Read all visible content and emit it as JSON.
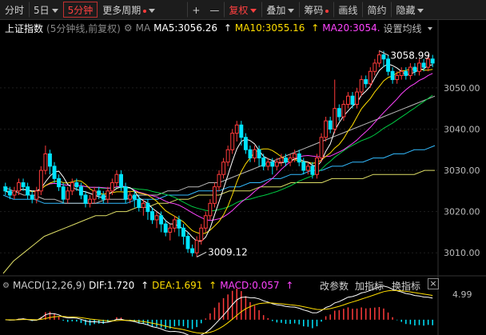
{
  "toolbar": {
    "items": [
      "分时",
      "5日",
      "5分钟",
      "更多周期",
      "+",
      "—",
      "复权",
      "叠加",
      "筹码",
      "画线",
      "简约",
      "隐藏"
    ]
  },
  "info": {
    "index_name": "上证指数",
    "period_desc": "(5分钟线,前复权)",
    "ma_label": "MA",
    "ma5": "MA5:3056.26",
    "ma10": "MA10:3055.16",
    "ma20": "MA20:3054.",
    "settings": "设置均线"
  },
  "macd": {
    "label": "MACD(12,26,9)",
    "dif": "DIF:1.720",
    "dea": "DEA:1.691",
    "macd": "MACD:0.057",
    "btn_params": "改参数",
    "btn_add": "加指标",
    "btn_switch": "换指标"
  },
  "colors": {
    "up": "#ff3b3b",
    "down": "#00e5ff",
    "ma5": "#ffffff",
    "ma10": "#ffdd00",
    "ma20": "#ff44ff",
    "ma30": "#00cc44",
    "ma60": "#bbbbbb",
    "ma120": "#33bbff",
    "ma250": "#dddd66"
  },
  "chart_data": {
    "type": "candlestick",
    "y_ticks": [
      "3050.00",
      "3040.00",
      "3030.00",
      "3020.00",
      "3010.00"
    ],
    "ylim": [
      3005,
      3062
    ],
    "high_label": "3058.99",
    "low_label": "3009.12",
    "bars": [
      [
        3026,
        3025,
        3027,
        3024
      ],
      [
        3025,
        3024,
        3026,
        3023
      ],
      [
        3024,
        3025,
        3026,
        3023
      ],
      [
        3025,
        3027,
        3028,
        3024
      ],
      [
        3027,
        3026,
        3028,
        3025
      ],
      [
        3026,
        3024,
        3027,
        3023
      ],
      [
        3024,
        3023,
        3025,
        3022
      ],
      [
        3023,
        3025,
        3026,
        3022
      ],
      [
        3025,
        3030,
        3031,
        3024
      ],
      [
        3030,
        3034,
        3036,
        3029
      ],
      [
        3034,
        3031,
        3035,
        3029
      ],
      [
        3031,
        3028,
        3032,
        3027
      ],
      [
        3028,
        3026,
        3029,
        3025
      ],
      [
        3026,
        3023,
        3027,
        3022
      ],
      [
        3023,
        3025,
        3026,
        3022
      ],
      [
        3025,
        3027,
        3028,
        3024
      ],
      [
        3027,
        3026,
        3028,
        3025
      ],
      [
        3026,
        3024,
        3027,
        3023
      ],
      [
        3024,
        3022,
        3025,
        3021
      ],
      [
        3022,
        3023,
        3024,
        3021
      ],
      [
        3023,
        3025,
        3026,
        3022
      ],
      [
        3025,
        3024,
        3026,
        3023
      ],
      [
        3024,
        3023,
        3025,
        3022
      ],
      [
        3023,
        3025,
        3026,
        3022
      ],
      [
        3025,
        3027,
        3028,
        3024
      ],
      [
        3027,
        3029,
        3030,
        3026
      ],
      [
        3029,
        3026,
        3030,
        3025
      ],
      [
        3026,
        3023,
        3027,
        3022
      ],
      [
        3023,
        3024,
        3025,
        3022
      ],
      [
        3024,
        3023,
        3025,
        3021
      ],
      [
        3023,
        3021,
        3024,
        3020
      ],
      [
        3021,
        3022,
        3023,
        3019
      ],
      [
        3022,
        3020,
        3023,
        3018
      ],
      [
        3020,
        3018,
        3021,
        3017
      ],
      [
        3018,
        3019,
        3020,
        3016
      ],
      [
        3019,
        3017,
        3020,
        3015
      ],
      [
        3017,
        3015,
        3018,
        3014
      ],
      [
        3015,
        3016,
        3017,
        3013
      ],
      [
        3016,
        3018,
        3019,
        3015
      ],
      [
        3018,
        3016,
        3019,
        3014
      ],
      [
        3016,
        3014,
        3017,
        3012
      ],
      [
        3014,
        3011,
        3015,
        3010
      ],
      [
        3011,
        3010,
        3012,
        3009.12
      ],
      [
        3010,
        3013,
        3014,
        3009
      ],
      [
        3013,
        3016,
        3017,
        3012
      ],
      [
        3016,
        3019,
        3020,
        3015
      ],
      [
        3019,
        3022,
        3023,
        3018
      ],
      [
        3022,
        3026,
        3027,
        3021
      ],
      [
        3026,
        3029,
        3030,
        3025
      ],
      [
        3029,
        3032,
        3033,
        3028
      ],
      [
        3032,
        3035,
        3036,
        3031
      ],
      [
        3035,
        3039,
        3040,
        3034
      ],
      [
        3039,
        3041,
        3042,
        3037
      ],
      [
        3041,
        3038,
        3042,
        3036
      ],
      [
        3038,
        3035,
        3039,
        3034
      ],
      [
        3035,
        3033,
        3036,
        3032
      ],
      [
        3033,
        3035,
        3036,
        3032
      ],
      [
        3035,
        3033,
        3036,
        3031
      ],
      [
        3033,
        3031,
        3034,
        3030
      ],
      [
        3031,
        3032,
        3033,
        3030
      ],
      [
        3032,
        3031,
        3033,
        3029
      ],
      [
        3031,
        3032,
        3033,
        3030
      ],
      [
        3032,
        3033,
        3034,
        3031
      ],
      [
        3033,
        3032,
        3034,
        3031
      ],
      [
        3032,
        3033,
        3034,
        3031
      ],
      [
        3033,
        3034,
        3035,
        3032
      ],
      [
        3034,
        3032,
        3035,
        3031
      ],
      [
        3032,
        3030,
        3033,
        3029
      ],
      [
        3030,
        3031,
        3032,
        3029
      ],
      [
        3031,
        3029,
        3032,
        3028
      ],
      [
        3029,
        3033,
        3034,
        3028
      ],
      [
        3033,
        3038,
        3039,
        3032
      ],
      [
        3038,
        3042,
        3043,
        3037
      ],
      [
        3042,
        3040,
        3043,
        3039
      ],
      [
        3040,
        3045,
        3052,
        3039
      ],
      [
        3045,
        3043,
        3046,
        3042
      ],
      [
        3043,
        3046,
        3047,
        3042
      ],
      [
        3046,
        3048,
        3049,
        3045
      ],
      [
        3048,
        3046,
        3049,
        3045
      ],
      [
        3046,
        3049,
        3050,
        3045
      ],
      [
        3049,
        3052,
        3053,
        3048
      ],
      [
        3052,
        3051,
        3053,
        3050
      ],
      [
        3051,
        3054,
        3055,
        3050
      ],
      [
        3054,
        3056,
        3057,
        3053
      ],
      [
        3056,
        3058,
        3059,
        3055
      ],
      [
        3058,
        3057,
        3058.99,
        3055
      ],
      [
        3057,
        3054,
        3058,
        3053
      ],
      [
        3054,
        3052,
        3055,
        3051
      ],
      [
        3052,
        3053,
        3054,
        3051
      ],
      [
        3053,
        3054,
        3055,
        3052
      ],
      [
        3054,
        3053,
        3055,
        3052
      ],
      [
        3053,
        3055,
        3056,
        3052
      ],
      [
        3055,
        3054,
        3056,
        3053
      ],
      [
        3054,
        3056,
        3057,
        3053
      ],
      [
        3056,
        3055,
        3057,
        3054
      ],
      [
        3055,
        3057,
        3058,
        3054
      ],
      [
        3057,
        3056,
        3058,
        3055
      ]
    ],
    "ma_long": {
      "ma60": [
        3026,
        3025,
        3024,
        3024,
        3023,
        3023,
        3022,
        3022,
        3022,
        3022,
        3023,
        3023,
        3023,
        3024,
        3024,
        3024,
        3025,
        3025,
        3026,
        3026,
        3027,
        3027,
        3028,
        3029,
        3030,
        3031,
        3032,
        3033,
        3034,
        3035,
        3036,
        3037,
        3038,
        3039,
        3040,
        3041,
        3042,
        3043,
        3044,
        3045,
        3046,
        3047,
        3048
      ],
      "ma120": [
        3024,
        3023,
        3023,
        3023,
        3022,
        3022,
        3022,
        3022,
        3022,
        3022,
        3022,
        3022,
        3022,
        3023,
        3023,
        3023,
        3024,
        3024,
        3024,
        3025,
        3025,
        3025,
        3026,
        3026,
        3027,
        3027,
        3028,
        3028,
        3029,
        3029,
        3030,
        3030,
        3031,
        3031,
        3032,
        3032,
        3033,
        3033,
        3034,
        3034,
        3035,
        3035,
        3036
      ],
      "ma250": [
        3005,
        3008,
        3010,
        3012,
        3014,
        3015,
        3016,
        3017,
        3018,
        3019,
        3019,
        3020,
        3020,
        3021,
        3021,
        3022,
        3022,
        3023,
        3023,
        3024,
        3024,
        3024,
        3025,
        3025,
        3025,
        3026,
        3026,
        3026,
        3027,
        3027,
        3027,
        3027,
        3028,
        3028,
        3028,
        3028,
        3029,
        3029,
        3029,
        3029,
        3029,
        3030,
        3030
      ]
    },
    "macd_yticks": [
      "4.99"
    ],
    "macd_ylim": [
      -3,
      5
    ]
  }
}
